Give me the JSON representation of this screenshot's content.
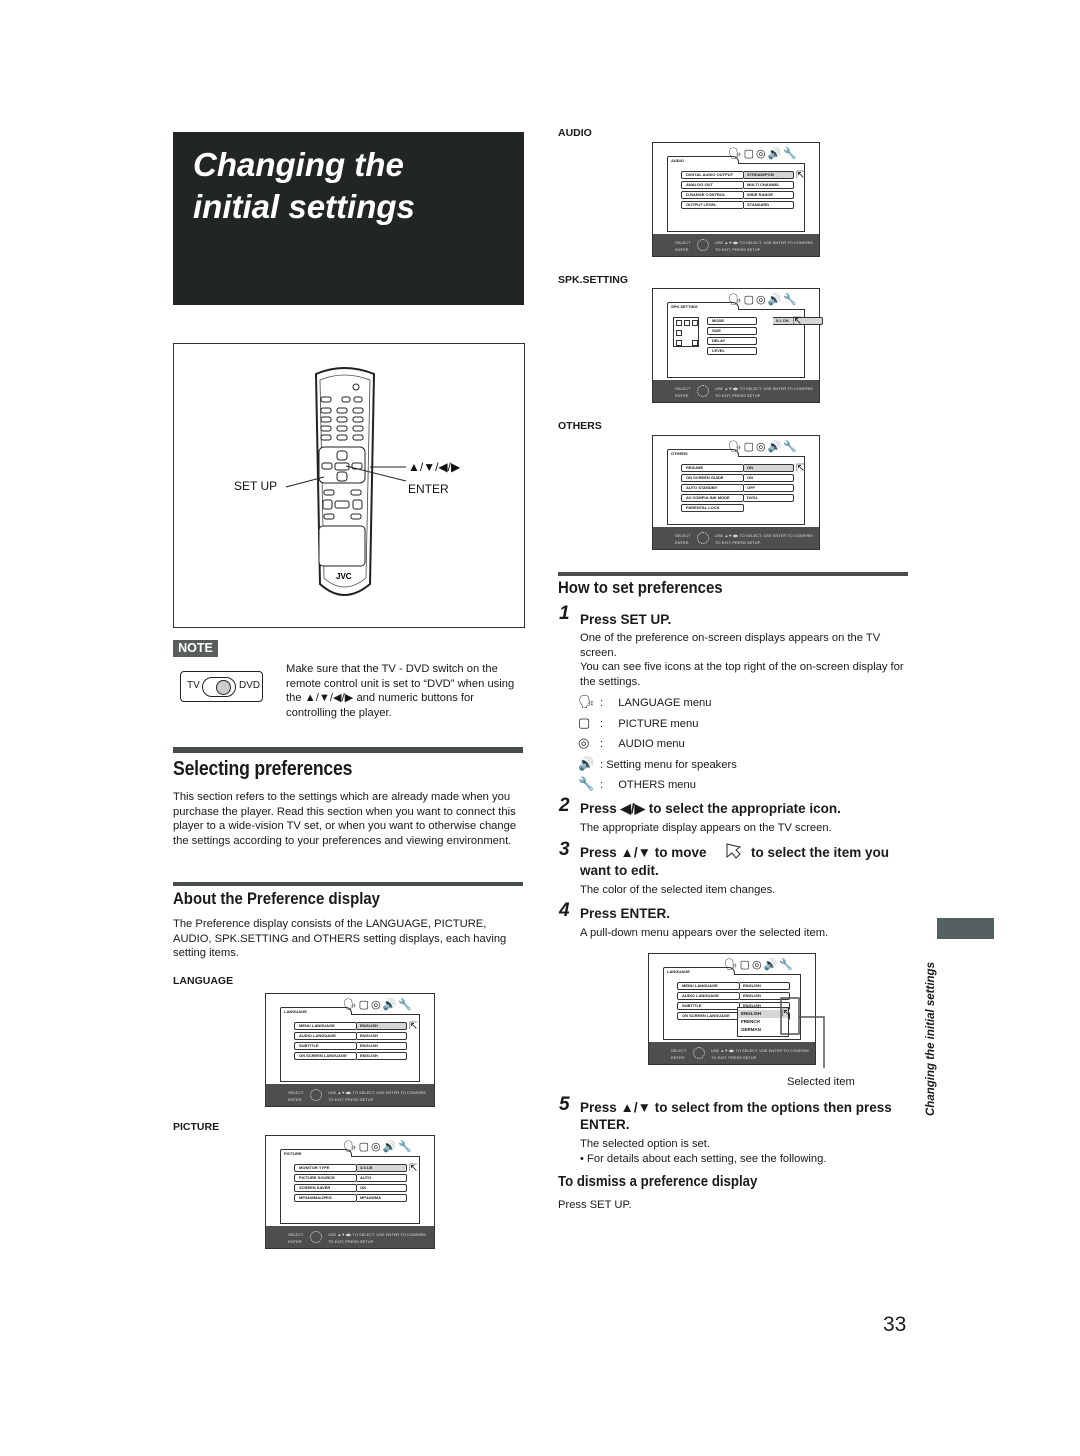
{
  "page": {
    "title_line1": "Changing the",
    "title_line2": "initial settings",
    "side_label": "Changing the initial settings",
    "page_number": "33"
  },
  "remote": {
    "brand": "JVC",
    "label_setup": "SET UP",
    "label_arrows": "▲/▼/◀/▶",
    "label_enter": "ENTER"
  },
  "note": {
    "badge": "NOTE",
    "switch_left": "TV",
    "switch_right": "DVD",
    "text": "Make sure that the TV - DVD switch on the remote control unit is set to “DVD” when using the ▲/▼/◀/▶ and numeric buttons for controlling the player."
  },
  "selecting": {
    "heading": "Selecting preferences",
    "body": "This section refers to the settings which are already made when you purchase the player. Read this section when you want to connect this player to a wide-vision TV set, or when you want to otherwise change the settings according to your preferences and viewing environment."
  },
  "about": {
    "heading": "About the Preference display",
    "body": "The Preference display consists of the LANGUAGE, PICTURE, AUDIO, SPK.SETTING and OTHERS setting displays, each having setting items."
  },
  "osd_common": {
    "icons": "🗣▢◎🔊🔧",
    "footer_select": "SELECT",
    "footer_enter": "ENTER",
    "footer_msg1": "USE ▲▼◀▶ TO SELECT, USE ENTER TO CONFIRM",
    "footer_msg2": "TO EXIT, PRESS SETUP."
  },
  "screens": {
    "language": {
      "caption": "LANGUAGE",
      "tab": "LANGUAGE",
      "rows": [
        {
          "k": "MENU LANGUAGE",
          "v": "ENGLISH"
        },
        {
          "k": "AUDIO LANGUAGE",
          "v": "ENGLISH"
        },
        {
          "k": "SUBTITLE",
          "v": "ENGLISH"
        },
        {
          "k": "ON SCREEN LANGUAGE",
          "v": "ENGLISH"
        }
      ]
    },
    "picture": {
      "caption": "PICTURE",
      "tab": "PICTURE",
      "rows": [
        {
          "k": "MONITOR TYPE",
          "v": "4:3 LB"
        },
        {
          "k": "PICTURE SOURCE",
          "v": "AUTO"
        },
        {
          "k": "SCREEN SAVER",
          "v": "ON"
        },
        {
          "k": "MP3&WMA/JPEG",
          "v": "MP3&WMA"
        }
      ]
    },
    "audio": {
      "caption": "AUDIO",
      "tab": "AUDIO",
      "rows": [
        {
          "k": "DIGITAL AUDIO OUTPUT",
          "v": "STREAM/PCM"
        },
        {
          "k": "ANALOG OUT",
          "v": "MULTI CHANNEL"
        },
        {
          "k": "D.RANGE CONTROL",
          "v": "WIDE RANGE"
        },
        {
          "k": "OUTPUT LEVEL",
          "v": "STANDARD"
        }
      ]
    },
    "spk": {
      "caption": "SPK.SETTING",
      "tab": "SPK.SETTING",
      "rows": [
        {
          "k": "MODE",
          "v": "5.1 CH."
        },
        {
          "k": "SIZE",
          "v": ""
        },
        {
          "k": "DELAY",
          "v": ""
        },
        {
          "k": "LEVEL",
          "v": ""
        }
      ]
    },
    "others": {
      "caption": "OTHERS",
      "tab": "OTHERS",
      "rows": [
        {
          "k": "RESUME",
          "v": "ON"
        },
        {
          "k": "ON SCREEN GUIDE",
          "v": "ON"
        },
        {
          "k": "AUTO STANDBY",
          "v": "OFF"
        },
        {
          "k": "AV COMPULINK MODE",
          "v": "DVD1"
        },
        {
          "k": "PARENTAL LOCK",
          "v": ""
        }
      ]
    },
    "pulldown": {
      "tab": "LANGUAGE",
      "rows": [
        {
          "k": "MENU LANGUAGE",
          "v": "ENGLISH"
        },
        {
          "k": "AUDIO LANGUAGE",
          "v": "ENGLISH"
        },
        {
          "k": "SUBTITLE",
          "v": "ENGLISH"
        },
        {
          "k": "ON SCREEN LANGUAGE",
          "v": "ENGLISH"
        }
      ],
      "options": [
        "ENGLISH",
        "FRENCH",
        "GERMAN"
      ],
      "callout": "Selected item"
    }
  },
  "howto": {
    "heading": "How to set preferences",
    "steps": [
      {
        "num": "1",
        "title": "Press SET UP.",
        "body1": "One of the preference on-screen displays appears on the TV screen.",
        "body2": "You can see five icons at the top right of the on-screen display for the settings."
      },
      {
        "num": "2",
        "title": "Press ◀/▶ to select the appropriate icon.",
        "body": "The appropriate display appears on the TV screen."
      },
      {
        "num": "3",
        "title_a": "Press ▲/▼ to move",
        "title_b": "to select the item you",
        "title_c": "want to edit.",
        "body": "The color of the selected item changes."
      },
      {
        "num": "4",
        "title": "Press ENTER.",
        "body": "A pull-down menu appears over the selected item."
      },
      {
        "num": "5",
        "title": "Press ▲/▼ to select from the options then press ENTER.",
        "body": "The selected option is set.",
        "bullet": "• For details about each setting, see the following."
      }
    ],
    "icons": [
      {
        "icon": "language-icon",
        "glyph": "🗣",
        "label": "LANGUAGE menu",
        "sep": ":"
      },
      {
        "icon": "picture-icon",
        "glyph": "▢",
        "label": "PICTURE menu",
        "sep": ":"
      },
      {
        "icon": "audio-icon",
        "glyph": "◎",
        "label": "AUDIO menu",
        "sep": ":"
      },
      {
        "icon": "speaker-icon",
        "glyph": "🔊",
        "label": "Setting menu for speakers",
        "sep": ":"
      },
      {
        "icon": "wrench-icon",
        "glyph": "🔧",
        "label": "OTHERS menu",
        "sep": ":"
      }
    ],
    "dismiss_heading": "To dismiss a preference display",
    "dismiss_body": "Press SET UP."
  }
}
